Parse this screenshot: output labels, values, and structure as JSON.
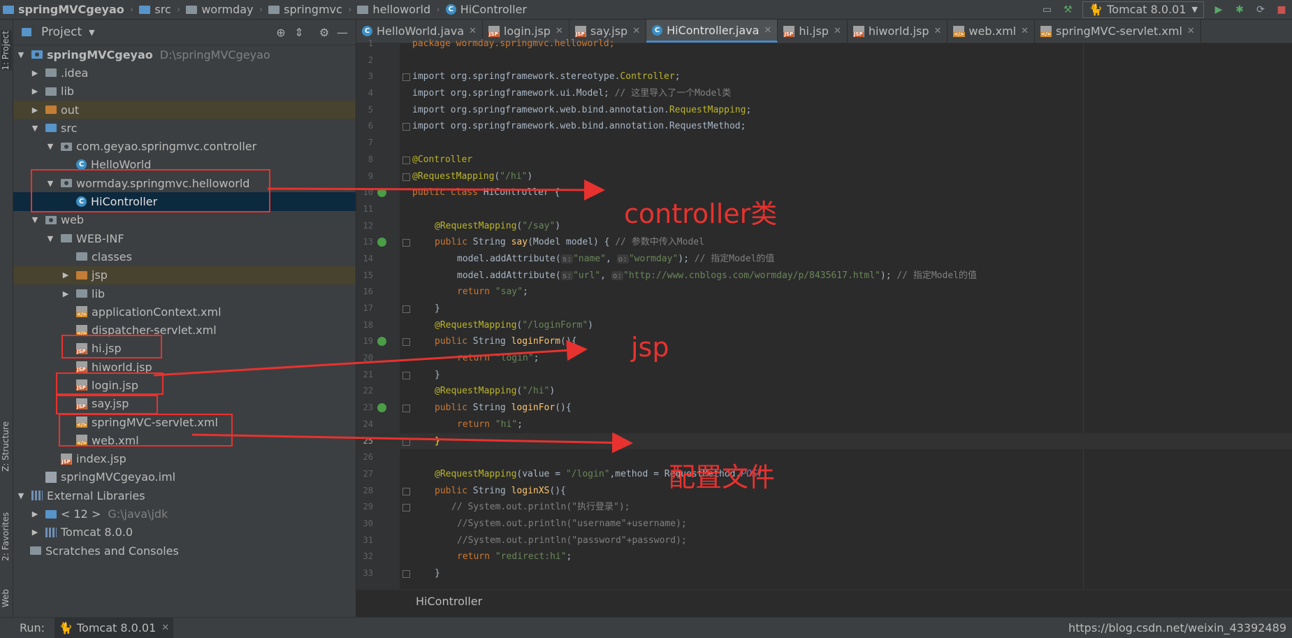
{
  "breadcrumbs": [
    "springMVCgeyao",
    "src",
    "wormday",
    "springmvc",
    "helloworld",
    "HiController"
  ],
  "run_config": "Tomcat 8.0.01",
  "left_tool_tabs": {
    "project": "1: Project",
    "structure": "Z: Structure",
    "favorites": "2: Favorites",
    "web": "Web"
  },
  "project_panel": {
    "title": "Project",
    "tree": [
      {
        "label": "springMVCgeyao",
        "note": "D:\\springMVCgeyao"
      },
      {
        "label": ".idea"
      },
      {
        "label": "lib"
      },
      {
        "label": "out"
      },
      {
        "label": "src"
      },
      {
        "label": "com.geyao.springmvc.controller"
      },
      {
        "label": "HelloWorld"
      },
      {
        "label": "wormday.springmvc.helloworld"
      },
      {
        "label": "HiController"
      },
      {
        "label": "web"
      },
      {
        "label": "WEB-INF"
      },
      {
        "label": "classes"
      },
      {
        "label": "jsp"
      },
      {
        "label": "lib"
      },
      {
        "label": "applicationContext.xml"
      },
      {
        "label": "dispatcher-servlet.xml"
      },
      {
        "label": "hi.jsp"
      },
      {
        "label": "hiworld.jsp"
      },
      {
        "label": "login.jsp"
      },
      {
        "label": "say.jsp"
      },
      {
        "label": "springMVC-servlet.xml"
      },
      {
        "label": "web.xml"
      },
      {
        "label": "index.jsp"
      },
      {
        "label": "springMVCgeyao.iml"
      },
      {
        "label": "External Libraries"
      },
      {
        "label": "< 12 >",
        "note": "G:\\java\\jdk"
      },
      {
        "label": "Tomcat 8.0.0"
      },
      {
        "label": "Scratches and Consoles"
      }
    ]
  },
  "editor_tabs": [
    {
      "label": "HelloWorld.java",
      "icon": "class-icon"
    },
    {
      "label": "login.jsp",
      "icon": "jsp-icon"
    },
    {
      "label": "say.jsp",
      "icon": "jsp-icon"
    },
    {
      "label": "HiController.java",
      "icon": "class-icon",
      "active": true
    },
    {
      "label": "hi.jsp",
      "icon": "jsp-icon"
    },
    {
      "label": "hiworld.jsp",
      "icon": "jsp-icon"
    },
    {
      "label": "web.xml",
      "icon": "xml-icon"
    },
    {
      "label": "springMVC-servlet.xml",
      "icon": "xml-icon"
    }
  ],
  "code_lines": [
    "1",
    "2",
    "3",
    "4",
    "5",
    "6",
    "7",
    "8",
    "9",
    "10",
    "11",
    "12",
    "13",
    "14",
    "15",
    "16",
    "17",
    "18",
    "19",
    "20",
    "21",
    "22",
    "23",
    "24",
    "25",
    "26",
    "27",
    "28",
    "29",
    "30",
    "31",
    "32",
    "33"
  ],
  "code": {
    "l1": "package wormday.springmvc.helloworld;",
    "l3a": "import org.springframework.stereotype.",
    "l3b": "Controller",
    "l4a": "import org.springframework.ui.Model; ",
    "l4b": "// 这里导入了一个Model类",
    "l5a": "import org.springframework.web.bind.annotation.",
    "l5b": "RequestMapping",
    "l6": "import org.springframework.web.bind.annotation.RequestMethod;",
    "l8": "@Controller",
    "l9a": "@RequestMapping",
    "l9b": "\"/hi\"",
    "l10a": "public class ",
    "l10b": "HiController {",
    "l12a": "@RequestMapping",
    "l12b": "\"/say\"",
    "l13a": "public ",
    "l13b": "String ",
    "l13c": "say",
    "l13d": "(Model model) { ",
    "l13e": "// 参数中传入Model",
    "l14a": "model.addAttribute(",
    "l14h1": "s:",
    "l14s1": "\"name\"",
    "l14h2": "o:",
    "l14s2": "\"wormday\"",
    "l14c": "); ",
    "l14d": "// 指定Model的值",
    "l15a": "model.addAttribute(",
    "l15h1": "s:",
    "l15s1": "\"url\"",
    "l15h2": "o:",
    "l15s2": "\"http://www.cnblogs.com/wormday/p/8435617.html\"",
    "l15c": "); ",
    "l15d": "// 指定Model的值",
    "l16a": "return ",
    "l16b": "\"say\"",
    "l17": "}",
    "l18a": "@RequestMapping",
    "l18b": "\"/loginForm\"",
    "l19a": "public ",
    "l19b": "String ",
    "l19c": "loginForm",
    "l19d": "(){",
    "l20a": "return ",
    "l20b": "\"login\"",
    "l21": "}",
    "l22a": "@RequestMapping",
    "l22b": "\"/hi\"",
    "l23a": "public ",
    "l23b": "String ",
    "l23c": "loginFor",
    "l23d": "(){",
    "l24a": "return ",
    "l24b": "\"hi\"",
    "l25": "}",
    "l27a": "@RequestMapping",
    "l27b": "(value = ",
    "l27c": "\"/login\"",
    "l27d": ",method = RequestMethod.",
    "l27e": "POST",
    "l28a": "public ",
    "l28b": "String ",
    "l28c": "loginXS",
    "l28d": "(){",
    "l29a": "// System.out.println(",
    "l29b": "\"执行登录\"",
    "l29c": ");",
    "l30": "//System.out.println(\"username\"+username);",
    "l31": "//System.out.println(\"password\"+password);",
    "l32a": "return ",
    "l32b": "\"redirect:hi\"",
    "l33": "}"
  },
  "editor_breadcrumb": "HiController",
  "annotations": {
    "controller": "controller类",
    "jsp": "jsp",
    "config": "配置文件"
  },
  "bottom": {
    "run_label": "Run:",
    "run_tab": "Tomcat 8.0.01",
    "watermark": "https://blog.csdn.net/weixin_43392489"
  },
  "colors": {
    "annotation_red": "#e8322f",
    "active_tab_underline": "#4a88c7",
    "selection": "#0d293e"
  }
}
